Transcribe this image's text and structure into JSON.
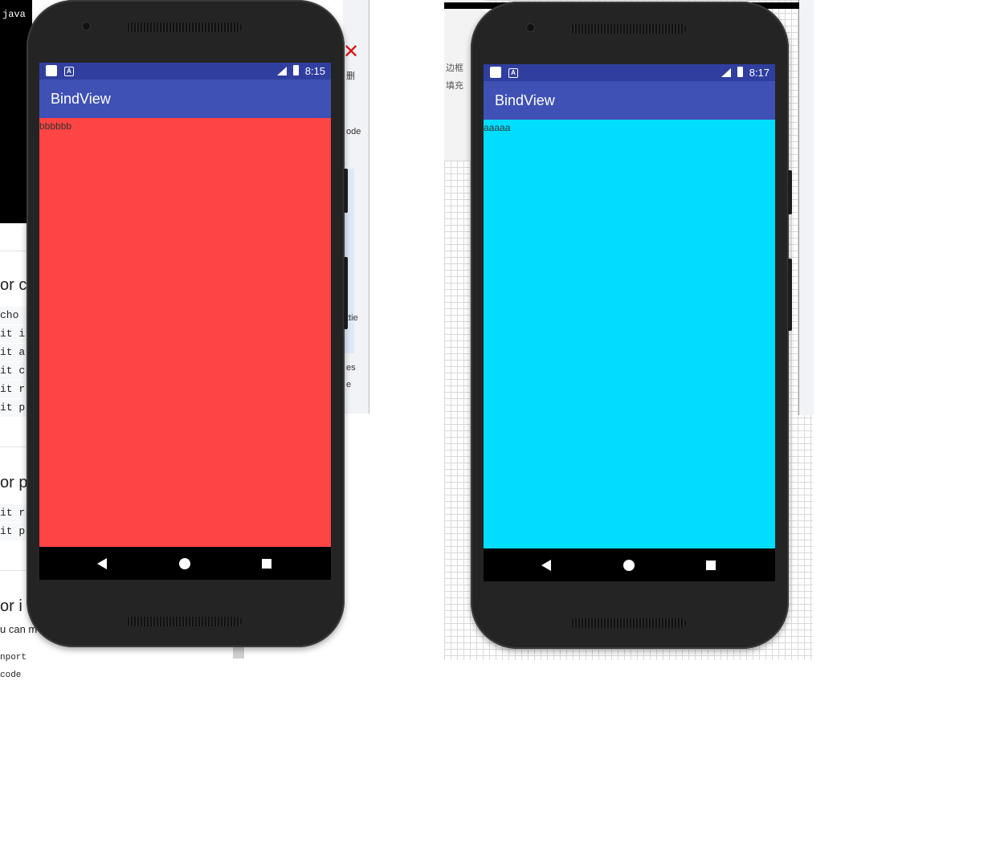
{
  "background": {
    "terminal_text": "java",
    "doc_headings": [
      "or c",
      "or p",
      "or i"
    ],
    "doc_lines_1": [
      "cho",
      "it i",
      "it a",
      "it c",
      "it r",
      "it p"
    ],
    "doc_lines_2": [
      "it r",
      "it p"
    ],
    "doc_tail": [
      "u can m",
      "nport code"
    ],
    "right_fragments": [
      "删",
      "ode",
      "ttie",
      "es",
      "e"
    ],
    "grid_labels": [
      "边框",
      "填充"
    ]
  },
  "phones": [
    {
      "time": "8:15",
      "app_title": "BindView",
      "content_text": "bbbbbb",
      "content_color": "#ff4444"
    },
    {
      "time": "8:17",
      "app_title": "BindView",
      "content_text": "aaaaa",
      "content_color": "#00ddff"
    }
  ],
  "colors": {
    "status_bar": "#303f9f",
    "app_bar": "#3f51b5"
  }
}
